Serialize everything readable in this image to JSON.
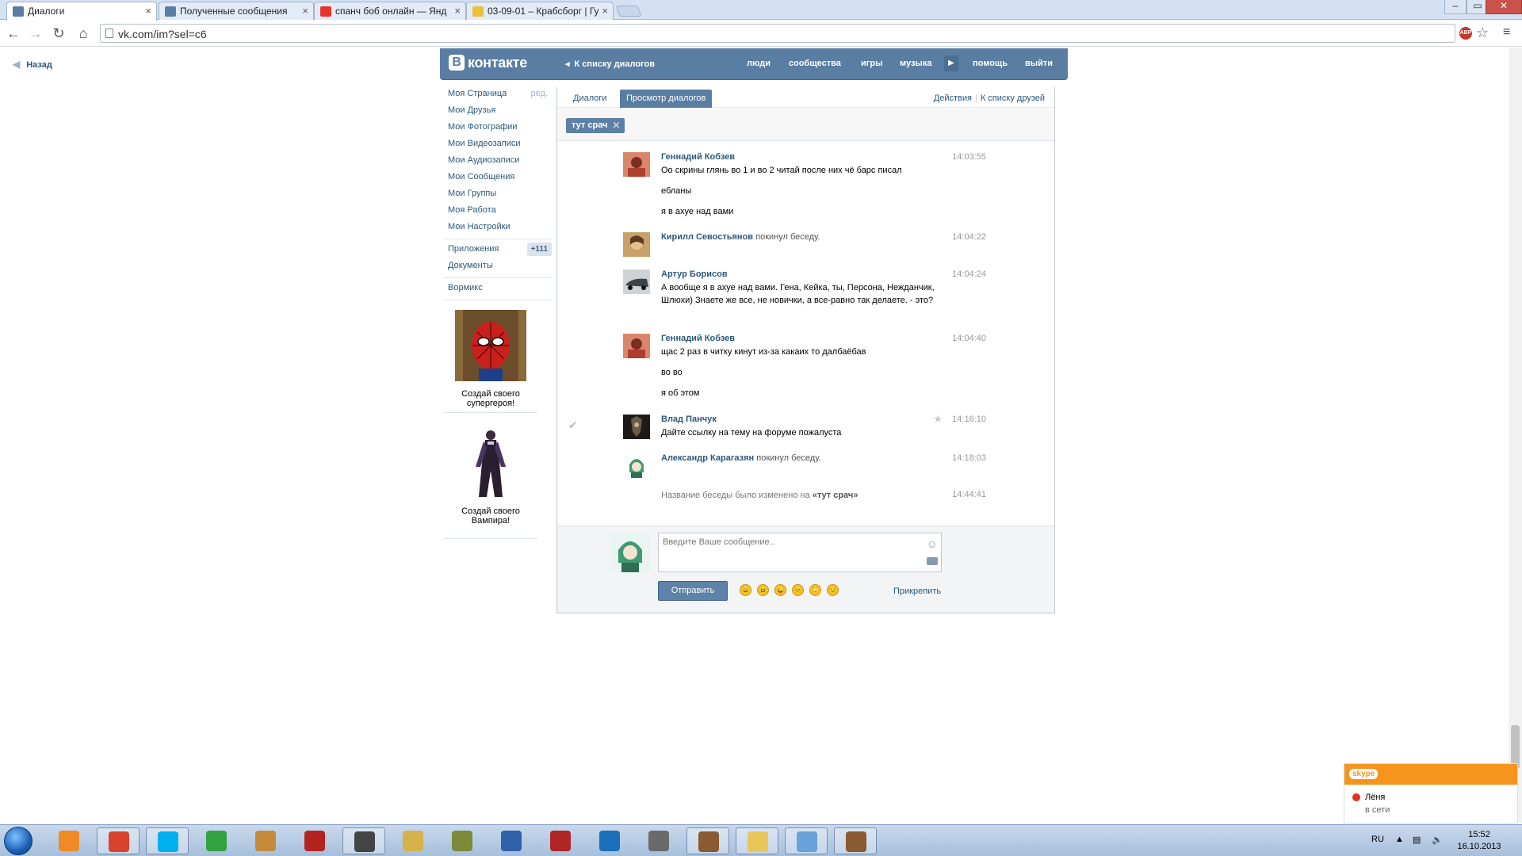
{
  "browser": {
    "tabs": [
      {
        "title": "Диалоги",
        "active": true,
        "favicon_color": "#597da3"
      },
      {
        "title": "Полученные сообщения",
        "active": false,
        "favicon_color": "#5d7ea3"
      },
      {
        "title": "спанч боб онлайн — Янд",
        "active": false,
        "favicon_color": "#e8332a"
      },
      {
        "title": "03-09-01 – Крабсборг | Гу",
        "active": false,
        "favicon_color": "#e7c23a"
      }
    ],
    "window_buttons": {
      "minimize": "–",
      "maximize": "▭",
      "close": "✕"
    },
    "url": "vk.com/im?sel=c6",
    "abp_label": "ABP"
  },
  "page": {
    "back_label": "Назад"
  },
  "vk": {
    "logo_b": "В",
    "logo_text": "контакте",
    "back_to_list": "К списку диалогов",
    "nav": [
      "люди",
      "сообщества",
      "игры",
      "музыка",
      "помощь",
      "выйти"
    ],
    "accent": "#597da3"
  },
  "left_menu": {
    "items": [
      {
        "label": "Моя Страница",
        "extra": "ред."
      },
      {
        "label": "Мои Друзья"
      },
      {
        "label": "Мои Фотографии"
      },
      {
        "label": "Мои Видеозаписи"
      },
      {
        "label": "Мои Аудиозаписи"
      },
      {
        "label": "Мои Сообщения"
      },
      {
        "label": "Мои Группы"
      },
      {
        "label": "Моя Работа"
      },
      {
        "label": "Мои Настройки"
      }
    ],
    "apps": {
      "label": "Приложения",
      "badge": "+111"
    },
    "docs": "Документы",
    "extra_link": "Вормикс",
    "ads": [
      {
        "text": "Создай своего супергероя!"
      },
      {
        "text": "Создай своего Вампира!"
      }
    ]
  },
  "dialog": {
    "tabs": [
      {
        "label": "Диалоги",
        "selected": false
      },
      {
        "label": "Просмотр диалогов",
        "selected": true
      }
    ],
    "right_links": [
      "Действия",
      "К списку друзей"
    ],
    "chat_title": "тут срач",
    "messages": [
      {
        "author": "Геннадий Кобзев",
        "time": "14:03:55",
        "lines": [
          "Оо скрины глянь во 1 и во 2 читай после них чё барс писал",
          "ебланы",
          "я в ахуе над вами"
        ],
        "avatar_color": "#c0504d"
      },
      {
        "author": "Кирилл Севостьянов",
        "action": "покинул беседу.",
        "time": "14:04:22",
        "avatar_color": "#b38a5a"
      },
      {
        "author": "Артур Борисов",
        "time": "14:04:24",
        "lines": [
          "А вообще я в ахуе над вами. Гена, Кейка, ты, Персона, Нежданчик, Шлюхи) Знаете же все, не новички, а все-равно так делаете. - это?"
        ],
        "avatar_color": "#6d7076"
      },
      {
        "author": "Геннадий Кобзев",
        "time": "14:04:40",
        "lines": [
          "щас 2 раз в читку кинут из-за какаих то далбаёбав",
          "во во",
          "я об этом"
        ],
        "avatar_color": "#c0504d"
      },
      {
        "author": "Влад Панчук",
        "time": "14:16:10",
        "lines": [
          "Дайте ссылку на тему на форуме пожалуста"
        ],
        "avatar_color": "#2c2622"
      },
      {
        "author": "Александр Карагазян",
        "action": "покинул беседу.",
        "time": "14:18:03",
        "avatar_color": "#4a9a79"
      }
    ],
    "notice": {
      "text": "Название беседы было изменено на",
      "name": "«тут срач»",
      "time": "14:44:41"
    },
    "composer": {
      "placeholder": "Введите Ваше сообщение..",
      "send": "Отправить",
      "attach": "Прикрепить",
      "emoji": [
        "😀",
        "😆",
        "😜",
        "😊",
        "😳",
        "😒"
      ]
    }
  },
  "skype_popup": {
    "logo": "skype",
    "name": "Лёня",
    "status": "в сети"
  },
  "taskbar": {
    "lang": "RU",
    "time": "15:52",
    "date": "16.10.2013",
    "apps": [
      {
        "name": "media-player",
        "color": "#f08a24",
        "running": false
      },
      {
        "name": "chrome",
        "color": "#d7432f",
        "running": true
      },
      {
        "name": "skype",
        "color": "#00aff0",
        "running": true
      },
      {
        "name": "utorrent",
        "color": "#33a13f",
        "running": false
      },
      {
        "name": "minecraft",
        "color": "#c68a3c",
        "running": false
      },
      {
        "name": "spiderman-game",
        "color": "#b4241e",
        "running": false
      },
      {
        "name": "game-1",
        "color": "#444444",
        "running": true
      },
      {
        "name": "game-2",
        "color": "#d5b24a",
        "running": false
      },
      {
        "name": "game-3",
        "color": "#7d8a3a",
        "running": false
      },
      {
        "name": "vk-app",
        "color": "#2f62a8",
        "running": false
      },
      {
        "name": "game-4",
        "color": "#b02525",
        "running": false
      },
      {
        "name": "app-circle",
        "color": "#1b6fb8",
        "running": false
      },
      {
        "name": "world-of-tanks",
        "color": "#6a6a6a",
        "running": false
      },
      {
        "name": "game-5",
        "color": "#8a5a32",
        "running": true
      },
      {
        "name": "explorer",
        "color": "#e8c65a",
        "running": true
      },
      {
        "name": "paint",
        "color": "#6aa1d8",
        "running": true
      },
      {
        "name": "game-6",
        "color": "#8a5a32",
        "running": true
      }
    ]
  }
}
